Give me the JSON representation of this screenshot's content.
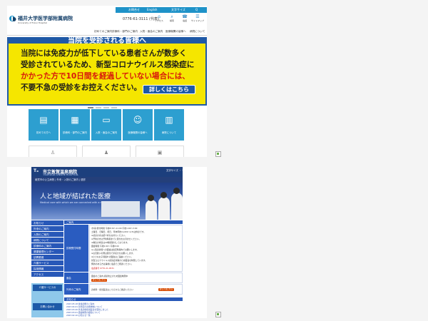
{
  "colors": {
    "accent": "#1e92c8",
    "tile": "#2d9fd0",
    "banner_blue": "#1f59a6",
    "banner_yellow": "#f5e600",
    "alert_red": "#d8180b",
    "navy": "#1c3f7d"
  },
  "shot1": {
    "topbar": [
      "お問合せ",
      "English",
      "文字サイズ",
      "Q"
    ],
    "hospital_name": "福井大学医学部附属病院",
    "hospital_sub": "University of Fukui Hospital",
    "phone": "0776-61-3111 (代表)",
    "top_icons": [
      {
        "icon": "access-icon",
        "label": "アクセス"
      },
      {
        "icon": "search-icon",
        "label": "検索"
      },
      {
        "icon": "phone-icon",
        "label": "電話"
      },
      {
        "icon": "sitemap-icon",
        "label": "サイトマップ"
      }
    ],
    "nav": [
      "初めてのご案内",
      "診療科・部門のご案内",
      "入院・面会のご案内",
      "医療機関の皆様へ",
      "病院について"
    ],
    "banner": {
      "title": "当院を受診される皆様へ",
      "line1": "当院には免疫力が低下している患者さんが数多く",
      "line2": "受診されているため、新型コロナウイルス感染症に",
      "line3": "かかった方で10日間を経過していない場合には、",
      "line4": "不要不急の受診をお控えください。",
      "button": "詳しくはこちら"
    },
    "tiles": [
      {
        "icon": "hospital-icon",
        "label": "初めての方へ"
      },
      {
        "icon": "stethoscope-icon",
        "label": "診療科・部門のご案内"
      },
      {
        "icon": "bed-icon",
        "label": "入院・面会のご案内"
      },
      {
        "icon": "doctor-icon",
        "label": "医療機関の皆様へ"
      },
      {
        "icon": "building-icon",
        "label": "病院について"
      }
    ],
    "cards": [
      "person-icon",
      "person-icon",
      "info-icon",
      "bus-icon"
    ]
  },
  "shot2": {
    "hospital_name": "市立敦賀温泉病院",
    "hospital_sub": "TSURUGA ONSEN HOSPITAL",
    "header_link": "文字サイズ ・ 色",
    "subnav": "敦賀市の公立病院 | 外来・入院のご案内 | 健診",
    "hero_title": "人と地域が結ばれた医療",
    "hero_sub": "Medical care with which we are connected with a region",
    "side_items": [
      "お知らせ",
      "外来のご案内",
      "入院のご案内",
      "病院について",
      "診療科のご案内",
      "健康管理センター",
      "訪問看護",
      "介護サービス",
      "採用情報",
      "アクセス"
    ],
    "side_banner_top": "介護サービスの",
    "side_banner_bottom": "お問い合わせ",
    "main_head": "ご案内",
    "row1_label": "診療受付時間",
    "row1_lines": [
      "(外来)受付時間 午前8:30〜11:00 午後1:00〜3:00",
      "土曜日、日曜日、祝日、年末年始(12/29〜1/3)は休診です。",
      "※初診の方は紹介状をお持ちください。",
      "※予約の方は予約時間までに受付をお済ませください。",
      "※救急の場合は24時間受付しております。",
      "面会時間 午後1:00〜午後8:00",
      "※入院患者様への面会は指定時間内でお願いします。",
      "※お見舞いの際は受付で手続きをお願いします。",
      "※小さなお子様連れの面会はご遠慮ください。",
      "新型コロナウイルス感染症対策のため面会を制限しています。",
      "発熱のある方は事前に電話でご相談ください。"
    ],
    "row1_alert": "電話番号 0770-21-0531",
    "row2_label": "面会",
    "row2_text": "面会のご案内 感染防止のため面会制限中",
    "row2_button": "詳しくはこちら",
    "row3_label": "外来のご案内",
    "row3_text": "診療科・担当医表はこちらからご確認ください",
    "row3_button": "詳しくはこちら",
    "news_head": "お知らせ",
    "news": [
      "2023.05.18 健康診断のご案内",
      "2023.04.01 新年度の診療体制について",
      "2023.03.20 外来診療担当医表を更新しました",
      "2023.03.01 面会制限の緩和について",
      "2023.02.10 お知らせ一覧"
    ]
  }
}
